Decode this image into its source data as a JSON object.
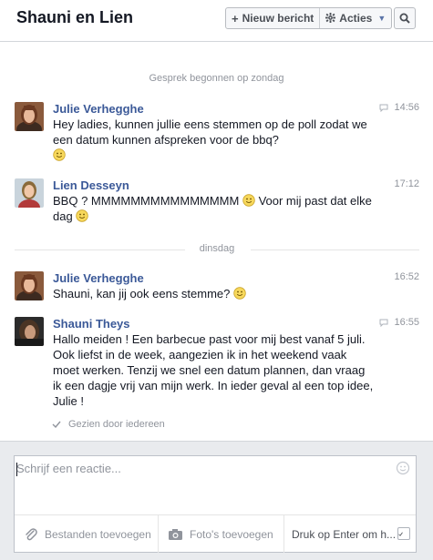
{
  "header": {
    "title": "Shauni en Lien",
    "new_message_label": "Nieuw bericht",
    "actions_label": "Acties"
  },
  "conversation": {
    "started": "Gesprek begonnen op zondag",
    "day_divider": "dinsdag",
    "messages": [
      {
        "author": "Julie Verhegghe",
        "time": "14:56",
        "text": "Hey ladies, kunnen jullie eens stemmen op de poll zodat we een datum kunnen afspreken voor de bbq?",
        "emoji": "smiley-icon"
      },
      {
        "author": "Lien Desseyn",
        "time": "17:12",
        "text_before": "BBQ ? MMMMMMMMMMMMMMM",
        "text_after": " Voor mij past dat elke dag",
        "emoji": "smiley-icon"
      },
      {
        "author": "Julie Verhegghe",
        "time": "16:52",
        "text": "Shauni, kan jij ook eens stemme?",
        "emoji": "smiley-icon"
      },
      {
        "author": "Shauni Theys",
        "time": "16:55",
        "text": "Hallo meiden ! Een barbecue past voor mij best vanaf 5 juli. Ook liefst in de week, aangezien ik in het weekend vaak moet werken. Tenzij we snel een datum plannen, dan vraag ik een dagje vrij van mijn werk. In ieder geval al een top idee, Julie !"
      }
    ],
    "seen_status": "Gezien door iedereen"
  },
  "composer": {
    "placeholder": "Schrijf een reactie...",
    "attach_label": "Bestanden toevoegen",
    "photo_label": "Foto's toevoegen",
    "enter_label": "Druk op Enter om h...",
    "enter_checked": true
  },
  "colors": {
    "author_link": "#3b5998",
    "muted": "#90949c",
    "composer_bg": "#e9ebee"
  }
}
